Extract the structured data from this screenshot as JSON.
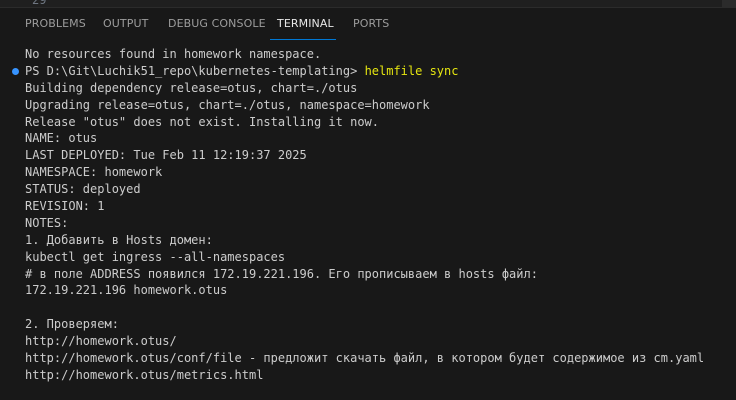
{
  "editor": {
    "line_number": "29"
  },
  "tabs": [
    {
      "label": "PROBLEMS",
      "active": false
    },
    {
      "label": "OUTPUT",
      "active": false
    },
    {
      "label": "DEBUG CONSOLE",
      "active": false
    },
    {
      "label": "TERMINAL",
      "active": true
    },
    {
      "label": "PORTS",
      "active": false
    }
  ],
  "colors": {
    "panel_background": "#181818",
    "text": "#cccccc",
    "command": "#e5e510",
    "prompt_marker": "#3794ff",
    "active_tab_underline": "#0078d4"
  },
  "terminal": {
    "line_1": "No resources found in homework namespace.",
    "prompt": "PS D:\\Git\\Luchik51_repo\\kubernetes-templating> ",
    "command": "helmfile sync",
    "output": [
      "Building dependency release=otus, chart=./otus",
      "Upgrading release=otus, chart=./otus, namespace=homework",
      "Release \"otus\" does not exist. Installing it now.",
      "NAME: otus",
      "LAST DEPLOYED: Tue Feb 11 12:19:37 2025",
      "NAMESPACE: homework",
      "STATUS: deployed",
      "REVISION: 1",
      "NOTES:",
      "1. Добавить в Hosts домен:",
      "kubectl get ingress --all-namespaces",
      "# в поле ADDRESS появился 172.19.221.196. Его прописываем в hosts файл:",
      "172.19.221.196 homework.otus",
      "",
      "2. Проверяем:",
      "http://homework.otus/",
      "http://homework.otus/conf/file - предложит скачать файл, в котором будет содержимое из cm.yaml",
      "http://homework.otus/metrics.html"
    ]
  }
}
